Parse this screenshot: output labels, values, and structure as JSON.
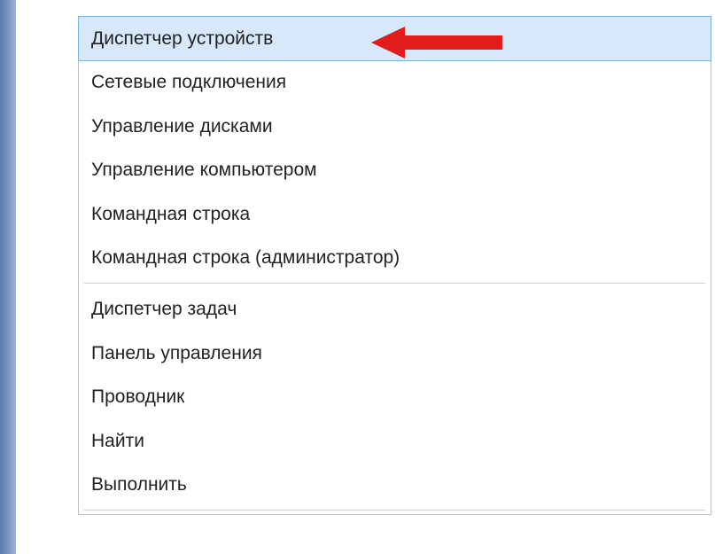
{
  "menu": {
    "group1": [
      "Диспетчер устройств",
      "Сетевые подключения",
      "Управление дисками",
      "Управление компьютером",
      "Командная строка",
      "Командная строка (администратор)"
    ],
    "group2": [
      "Диспетчер задач",
      "Панель управления",
      "Проводник",
      "Найти",
      "Выполнить"
    ],
    "highlighted_index": 0
  },
  "annotation": {
    "arrow_color": "#e21b1b"
  }
}
